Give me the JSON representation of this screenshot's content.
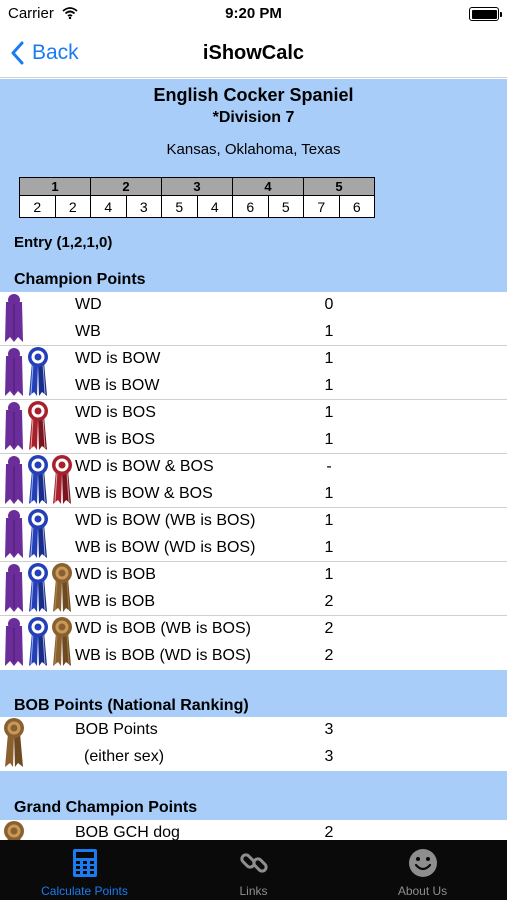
{
  "status_bar": {
    "carrier": "Carrier",
    "time": "9:20 PM"
  },
  "nav": {
    "back_label": "Back",
    "title": "iShowCalc"
  },
  "breed": {
    "name": "English Cocker Spaniel",
    "division": "*Division 7",
    "states": "Kansas, Oklahoma, Texas"
  },
  "points_table": {
    "headers": [
      "1",
      "2",
      "3",
      "4",
      "5"
    ],
    "values": [
      "2",
      "2",
      "4",
      "3",
      "5",
      "4",
      "6",
      "5",
      "7",
      "6"
    ]
  },
  "entry": "Entry (1,2,1,0)",
  "sections": {
    "champion_points": "Champion Points",
    "bob_points": "BOB Points (National Ranking)",
    "grand_champion_points": "Grand Champion Points"
  },
  "champion_rows": [
    {
      "label": "WD",
      "value": "0"
    },
    {
      "label": "WB",
      "value": "1"
    },
    {
      "label": "WD is BOW",
      "value": "1"
    },
    {
      "label": "WB is BOW",
      "value": "1"
    },
    {
      "label": "WD is BOS",
      "value": "1"
    },
    {
      "label": "WB is BOS",
      "value": "1"
    },
    {
      "label": "WD is BOW & BOS",
      "value": "-"
    },
    {
      "label": "WB is BOW & BOS",
      "value": "1"
    },
    {
      "label": "WD is BOW (WB is BOS)",
      "value": "1"
    },
    {
      "label": "WB is BOW (WD is BOS)",
      "value": "1"
    },
    {
      "label": "WD is BOB",
      "value": "1"
    },
    {
      "label": "WB is BOB",
      "value": "2"
    },
    {
      "label": "WD is BOB (WB is BOS)",
      "value": "2"
    },
    {
      "label": "WB is BOB (WD is BOS)",
      "value": "2"
    }
  ],
  "bob_rows": [
    {
      "label": "BOB Points",
      "value": "3"
    },
    {
      "label": "(either sex)",
      "value": "3"
    }
  ],
  "gch_rows": [
    {
      "label": "BOB GCH dog",
      "value": "2"
    }
  ],
  "ribbon_groups": [
    [
      "purple-ribbon-icon"
    ],
    [
      "purple-ribbon-icon",
      "blue-ribbon-icon"
    ],
    [
      "purple-ribbon-icon",
      "red-ribbon-icon"
    ],
    [
      "purple-ribbon-icon",
      "blue-ribbon-icon",
      "red-ribbon-icon"
    ],
    [
      "purple-ribbon-icon",
      "blue-ribbon-icon"
    ],
    [
      "purple-ribbon-icon",
      "blue-ribbon-icon",
      "bronze-ribbon-icon"
    ],
    [
      "purple-ribbon-icon",
      "blue-ribbon-icon",
      "bronze-ribbon-icon"
    ]
  ],
  "tabs": [
    {
      "label": "Calculate Points",
      "icon": "calculator-icon",
      "active": true
    },
    {
      "label": "Links",
      "icon": "chain-link-icon",
      "active": false
    },
    {
      "label": "About Us",
      "icon": "smiley-icon",
      "active": false
    }
  ],
  "colors": {
    "accent": "#1a7cf0",
    "content_background": "#a7cdf8",
    "tab_bar": "#0a0a0a",
    "purple_ribbon": "#6a2d9a",
    "blue_ribbon": "#2340b8",
    "red_ribbon": "#a8202c",
    "bronze_ribbon": "#8a6030"
  }
}
